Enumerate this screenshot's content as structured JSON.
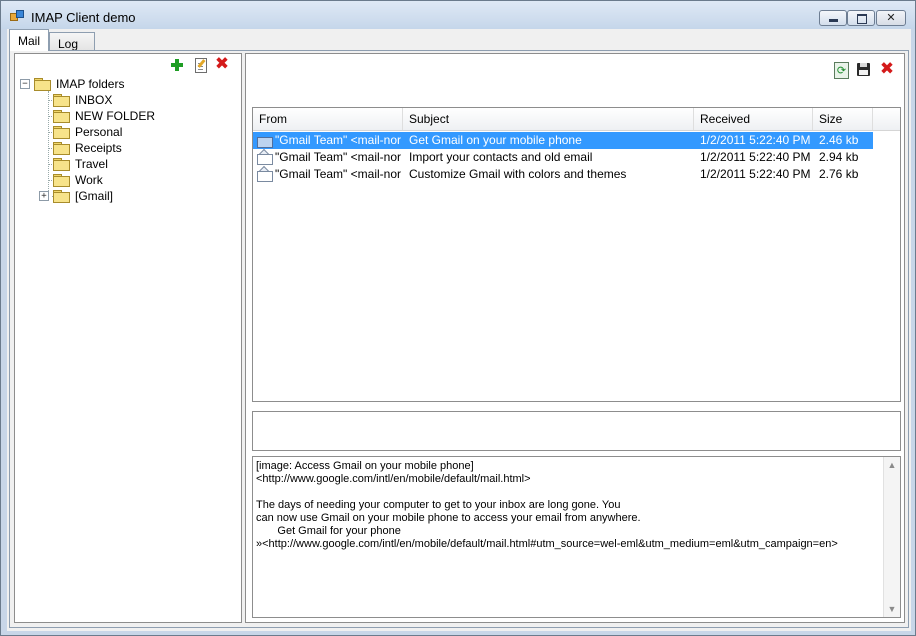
{
  "window": {
    "title": "IMAP Client demo",
    "controls": {
      "minimize_icon": "minimize-icon",
      "maximize_icon": "maximize-icon",
      "close_icon": "close-icon"
    }
  },
  "tabs": [
    {
      "label": "Mail",
      "active": true
    },
    {
      "label": "Log",
      "active": false
    }
  ],
  "folders_toolbar": {
    "icons": [
      "add-folder-icon",
      "rename-folder-icon",
      "delete-folder-icon"
    ]
  },
  "folders": {
    "root": "IMAP folders",
    "items": [
      "INBOX",
      "NEW FOLDER",
      "Personal",
      "Receipts",
      "Travel",
      "Work",
      "[Gmail]"
    ]
  },
  "messages_toolbar": {
    "icons": [
      "refresh-icon",
      "save-icon",
      "delete-message-icon"
    ]
  },
  "messages": {
    "columns": [
      "From",
      "Subject",
      "Received",
      "Size"
    ],
    "rows": [
      {
        "from": "\"Gmail Team\" <mail-nore...",
        "subject": "Get Gmail on your mobile phone",
        "received": "1/2/2011 5:22:40 PM",
        "size": "2.46 kb",
        "selected": true
      },
      {
        "from": "\"Gmail Team\" <mail-nore...",
        "subject": "Import your contacts and old email",
        "received": "1/2/2011 5:22:40 PM",
        "size": "2.94 kb",
        "selected": false
      },
      {
        "from": "\"Gmail Team\" <mail-nore...",
        "subject": "Customize Gmail with colors and themes",
        "received": "1/2/2011 5:22:40 PM",
        "size": "2.76 kb",
        "selected": false
      }
    ]
  },
  "preview": {
    "body": "[image: Access Gmail on your mobile phone]\n<http://www.google.com/intl/en/mobile/default/mail.html>\n\nThe days of needing your computer to get to your inbox are long gone. You\ncan now use Gmail on your mobile phone to access your email from anywhere.\n       Get Gmail for your phone\n»<http://www.google.com/intl/en/mobile/default/mail.html#utm_source=wel-eml&utm_medium=eml&utm_campaign=en>"
  },
  "colors": {
    "selection": "#3399ff",
    "titlebar": "#c5d6ea"
  }
}
